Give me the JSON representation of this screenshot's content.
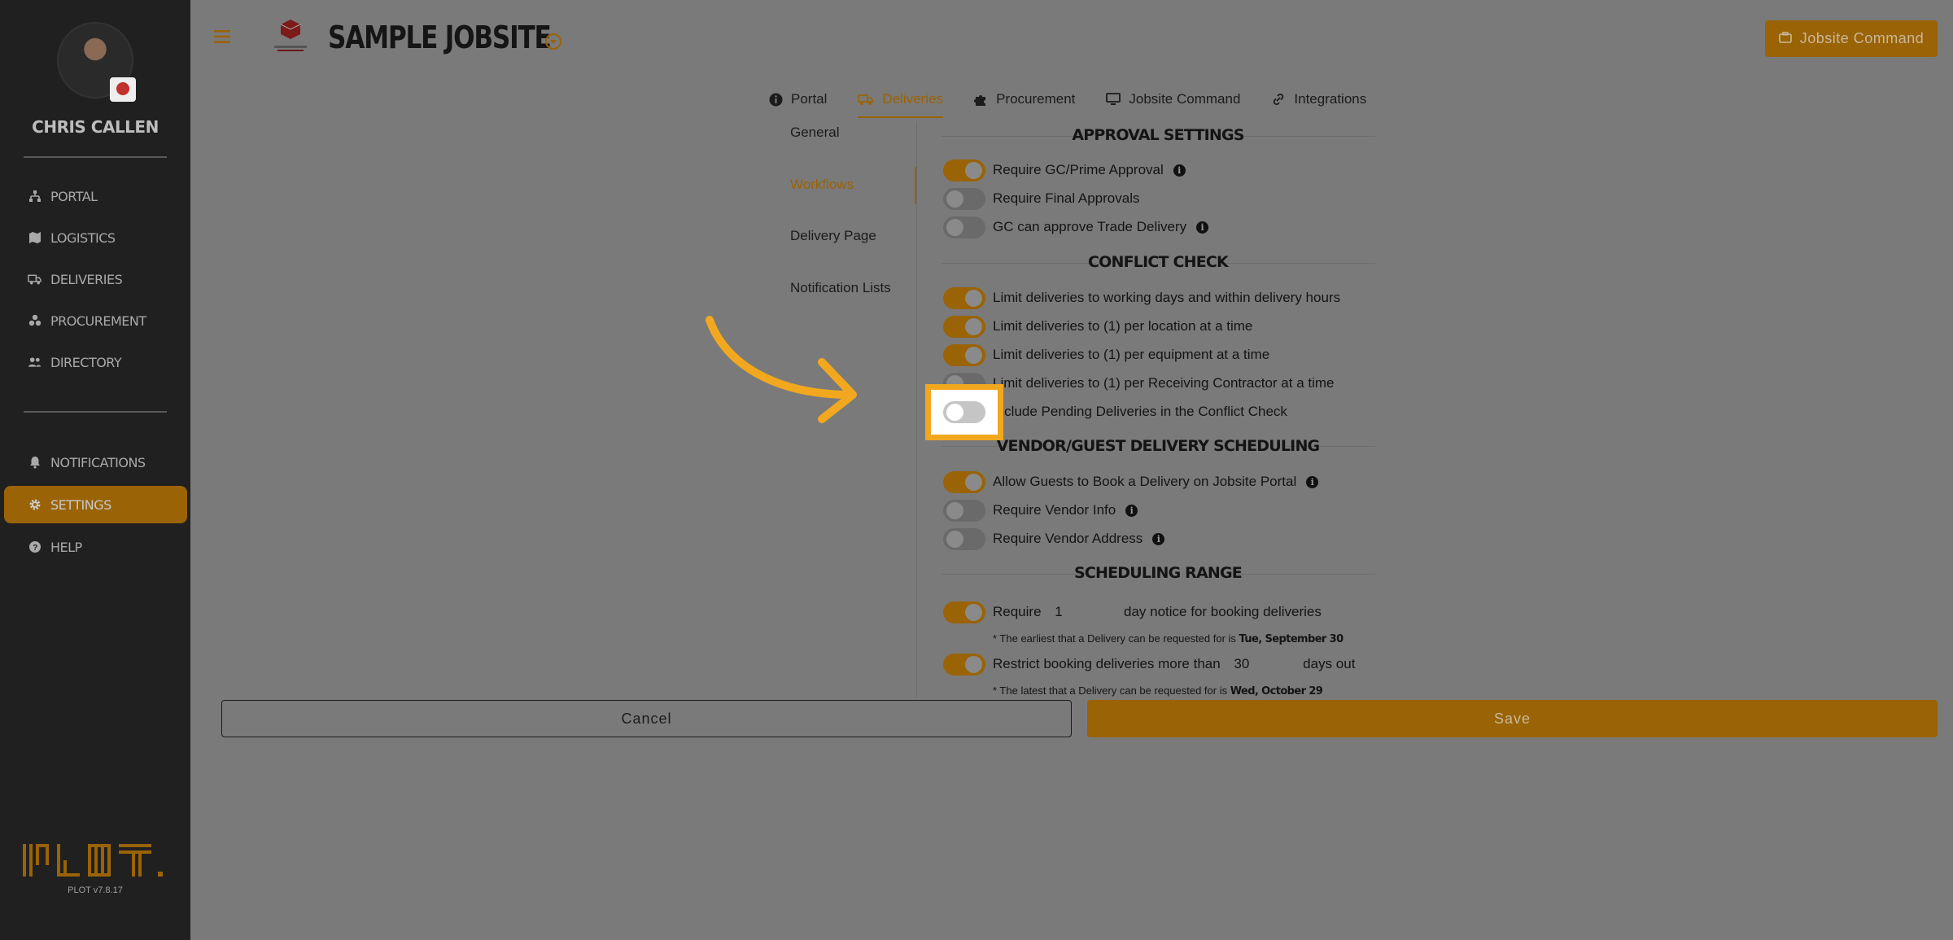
{
  "user": {
    "name": "CHRIS CALLEN"
  },
  "sidebar": {
    "items": [
      {
        "label": "PORTAL",
        "icon": "sitemap-icon"
      },
      {
        "label": "LOGISTICS",
        "icon": "map-icon"
      },
      {
        "label": "DELIVERIES",
        "icon": "truck-icon"
      },
      {
        "label": "PROCUREMENT",
        "icon": "boxes-icon"
      },
      {
        "label": "DIRECTORY",
        "icon": "people-icon"
      }
    ],
    "secondary": [
      {
        "label": "NOTIFICATIONS",
        "icon": "bell-icon"
      },
      {
        "label": "SETTINGS",
        "icon": "gear-icon",
        "active": true
      },
      {
        "label": "HELP",
        "icon": "question-icon"
      }
    ],
    "version": "PLOT v7.8.17"
  },
  "header": {
    "site_title": "SAMPLE JOBSITE",
    "command_button": "Jobsite Command"
  },
  "tabs": [
    {
      "label": "Portal",
      "icon": "info-icon"
    },
    {
      "label": "Deliveries",
      "icon": "truck-icon",
      "active": true
    },
    {
      "label": "Procurement",
      "icon": "puzzle-icon"
    },
    {
      "label": "Jobsite Command",
      "icon": "monitor-icon"
    },
    {
      "label": "Integrations",
      "icon": "link-icon"
    }
  ],
  "subnav": [
    "General",
    "Workflows",
    "Delivery Page",
    "Notification Lists"
  ],
  "subnav_active": "Workflows",
  "sections": {
    "approval": {
      "title": "APPROVAL SETTINGS",
      "rows": [
        {
          "label": "Require GC/Prime Approval",
          "on": true,
          "info": true
        },
        {
          "label": "Require Final Approvals",
          "on": false,
          "info": false
        },
        {
          "label": "GC can approve Trade Delivery",
          "on": false,
          "info": true
        }
      ]
    },
    "conflict": {
      "title": "CONFLICT CHECK",
      "rows": [
        {
          "label": "Limit deliveries to working days and within delivery hours",
          "on": true
        },
        {
          "label": "Limit deliveries to (1) per location at a time",
          "on": true
        },
        {
          "label": "Limit deliveries to (1) per equipment at a time",
          "on": true
        },
        {
          "label": "Limit deliveries to (1) per Receiving Contractor at a time",
          "on": false
        },
        {
          "label": "Include Pending Deliveries in the Conflict Check",
          "on": false
        }
      ]
    },
    "vendor": {
      "title": "VENDOR/GUEST DELIVERY SCHEDULING",
      "rows": [
        {
          "label": "Allow Guests to Book a Delivery on Jobsite Portal",
          "on": true,
          "info": true
        },
        {
          "label": "Require Vendor Info",
          "on": false,
          "info": true
        },
        {
          "label": "Require Vendor Address",
          "on": false,
          "info": true
        }
      ]
    },
    "range": {
      "title": "SCHEDULING RANGE",
      "notice": {
        "prefix": "Require",
        "value": "1",
        "suffix": "day notice for booking deliveries",
        "on": true
      },
      "notice_note": {
        "text": "* The earliest that a Delivery can be requested for is",
        "date": "Tue, September 30"
      },
      "restrict": {
        "prefix": "Restrict booking deliveries more than",
        "value": "30",
        "suffix": "days out",
        "on": true
      },
      "restrict_note": {
        "text": "* The latest that a Delivery can be requested for is",
        "date": "Wed, October 29"
      }
    }
  },
  "footer": {
    "cancel": "Cancel",
    "save": "Save"
  },
  "colors": {
    "accent": "#9a6306",
    "highlight": "#f2a81e",
    "sidebar": "#202020",
    "overlay": "#7a7a7a"
  }
}
